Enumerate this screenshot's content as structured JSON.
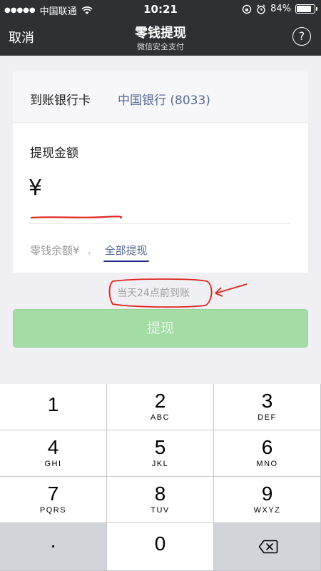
{
  "status_bar": {
    "carrier": "中国联通",
    "time": "10:21",
    "battery": "84%",
    "battery_level": 0.84
  },
  "nav": {
    "cancel_label": "取消",
    "title": "零钱提现",
    "subtitle": "微信安全支付",
    "help_label": "?"
  },
  "bank": {
    "label": "到账银行卡",
    "value": "中国银行 (8033)"
  },
  "amount": {
    "label": "提现金额",
    "currency_symbol": "¥"
  },
  "balance": {
    "prefix": "零钱余额¥",
    "hidden_value": "，",
    "withdraw_all": "全部提现"
  },
  "arrival_note": "当天24点前到账",
  "withdraw_button": "提现",
  "keypad": {
    "keys": [
      {
        "num": "1",
        "letters": ""
      },
      {
        "num": "2",
        "letters": "ABC"
      },
      {
        "num": "3",
        "letters": "DEF"
      },
      {
        "num": "4",
        "letters": "GHI"
      },
      {
        "num": "5",
        "letters": "JKL"
      },
      {
        "num": "6",
        "letters": "MNO"
      },
      {
        "num": "7",
        "letters": "PQRS"
      },
      {
        "num": "8",
        "letters": "TUV"
      },
      {
        "num": "9",
        "letters": "WXYZ"
      },
      {
        "num": ".",
        "letters": ""
      },
      {
        "num": "0",
        "letters": ""
      },
      {
        "num": "",
        "letters": ""
      }
    ]
  },
  "colors": {
    "nav_bg": "#2e3033",
    "link_blue": "#576b95",
    "button_green": "#a3dca4",
    "annotation_red": "#e0231b"
  }
}
